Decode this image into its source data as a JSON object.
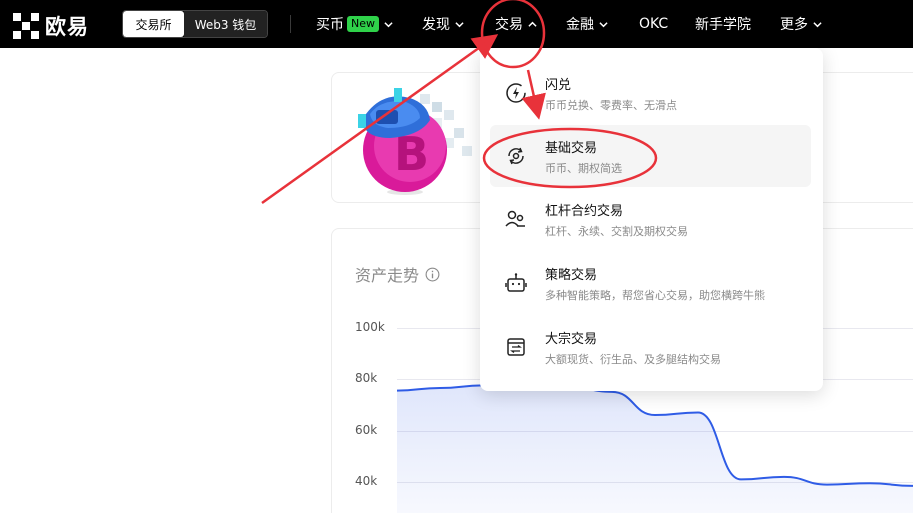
{
  "nav": {
    "brand": "欧易",
    "segment": {
      "exchange": "交易所",
      "web3": "Web3 钱包"
    },
    "items": [
      {
        "label": "买币",
        "badge": "New"
      },
      {
        "label": "发现"
      },
      {
        "label": "交易"
      },
      {
        "label": "金融"
      },
      {
        "label": "OKC"
      },
      {
        "label": "新手学院"
      },
      {
        "label": "更多"
      }
    ]
  },
  "dropdown": {
    "items": [
      {
        "title": "闪兑",
        "desc": "币币兑换、零费率、无滑点",
        "icon": "lightning-swap-icon"
      },
      {
        "title": "基础交易",
        "desc": "币币、期权简选",
        "icon": "refresh-circle-icon"
      },
      {
        "title": "杠杆合约交易",
        "desc": "杠杆、永续、交割及期权交易",
        "icon": "people-icon"
      },
      {
        "title": "策略交易",
        "desc": "多种智能策略，帮您省心交易，助您横跨牛熊",
        "icon": "robot-icon"
      },
      {
        "title": "大宗交易",
        "desc": "大额现货、衍生品、及多腿结构交易",
        "icon": "block-trade-icon"
      }
    ]
  },
  "asset": {
    "title": "资产走势",
    "yticks": [
      "100k",
      "80k",
      "60k",
      "40k"
    ]
  },
  "chart_data": {
    "type": "area",
    "title": "资产走势",
    "yticks": [
      "100k",
      "80k",
      "60k",
      "40k"
    ],
    "ylim": [
      30000,
      100000
    ],
    "series": [
      {
        "values": [
          75500,
          76500,
          77500,
          77500,
          77000,
          75000,
          66000,
          67000,
          41000,
          42000,
          39000,
          39500,
          38500
        ]
      }
    ],
    "grid": true
  },
  "colors": {
    "brand_black": "#000000",
    "badge_green": "#2fd24a",
    "chart_line": "#2f5ce6",
    "annotation_red": "#e8323a"
  }
}
